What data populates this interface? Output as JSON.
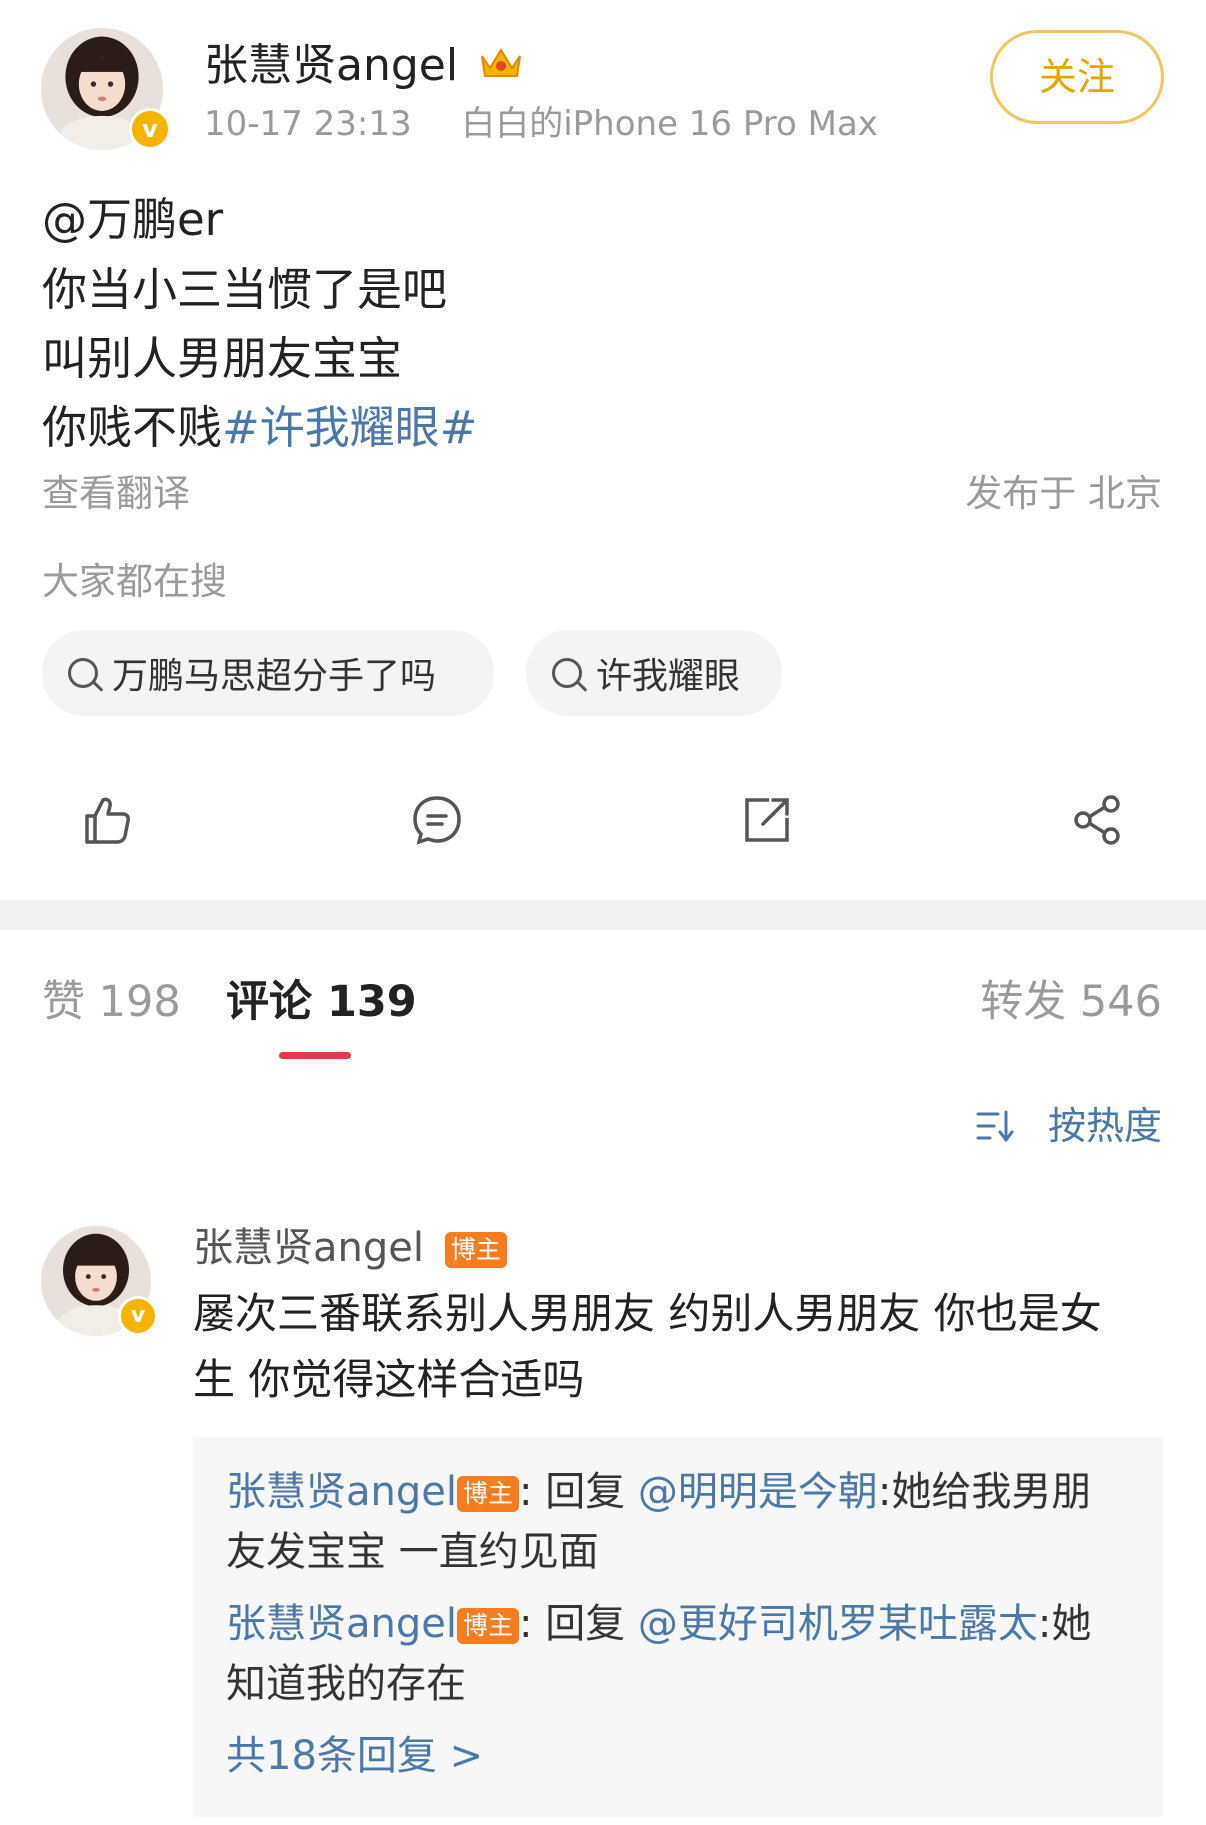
{
  "post": {
    "author": {
      "name": "张慧贤angel",
      "verified": true,
      "crown_icon": "crown-icon"
    },
    "meta": {
      "time": "10-17 23:13",
      "device": "白白的iPhone 16 Pro Max"
    },
    "follow_label": "关注",
    "mention": "@万鹏er",
    "lines": [
      "你当小三当惯了是吧",
      "叫别人男朋友宝宝",
      "你贱不贱"
    ],
    "hashtag": "#许我耀眼#",
    "translate_label": "查看翻译",
    "location": "发布于 北京",
    "search_heading": "大家都在搜",
    "search_chips": [
      "万鹏马思超分手了吗",
      "许我耀眼"
    ],
    "actions": [
      "like-icon",
      "comment-icon",
      "repost-icon",
      "share-icon"
    ]
  },
  "tabs": {
    "likes": "赞 198",
    "comments": "评论 139",
    "reposts": "转发 546"
  },
  "sort": {
    "label": "按热度",
    "icon": "sort-icon"
  },
  "comment": {
    "author": "张慧贤angel",
    "badge": "博主",
    "text_line1": "屡次三番联系别人男朋友 约别人男朋友 你也是女",
    "text_line2": "生 你觉得这样合适吗",
    "replies": [
      {
        "name": "张慧贤angel",
        "badge": "博主",
        "prefix": ": 回复 ",
        "target": "@明明是今朝",
        "text_a": ":她给我男朋",
        "text_b": "友发宝宝 一直约见面"
      },
      {
        "name": "张慧贤angel",
        "badge": "博主",
        "prefix": ": 回复 ",
        "target": "@更好司机罗某吐露太",
        "text_a": ":她",
        "text_b": "知道我的存在"
      }
    ],
    "more_replies": "共18条回复 >"
  },
  "colors": {
    "link": "#4a78a9",
    "follow": "#e8a400",
    "tab_underline": "#e8384f",
    "badge": "#f57c1f",
    "verified": "#f6b400"
  }
}
